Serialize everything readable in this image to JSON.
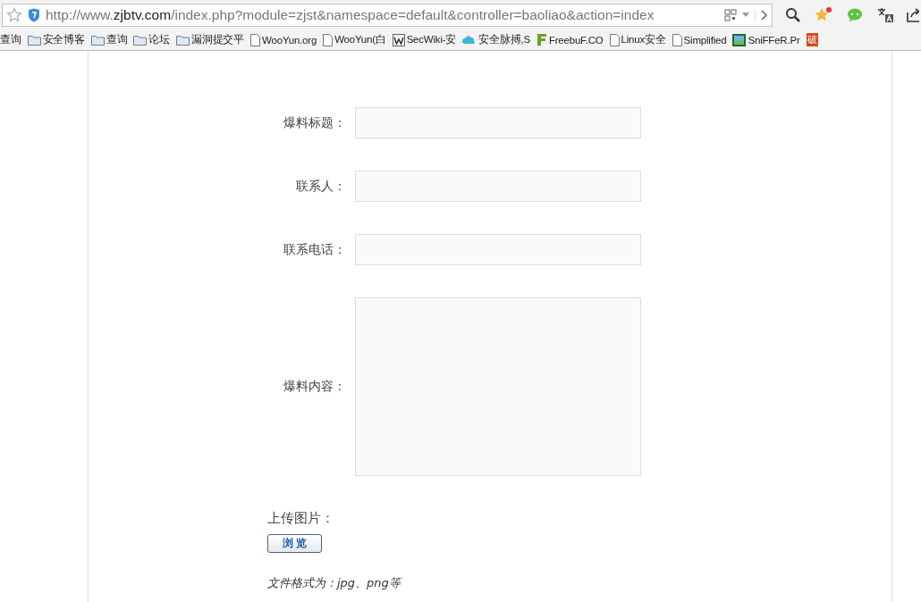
{
  "address_bar": {
    "url_prefix": "http://www.",
    "url_domain": "zjbtv.com",
    "url_path": "/index.php?module=zjst&namespace=default&controller=baoliao&action=index"
  },
  "bookmarks": [
    {
      "kind": "plain",
      "label": "查询"
    },
    {
      "kind": "folder",
      "label": "安全博客"
    },
    {
      "kind": "folder",
      "label": "查询"
    },
    {
      "kind": "folder",
      "label": "论坛"
    },
    {
      "kind": "folder",
      "label": "漏洞提交平"
    },
    {
      "kind": "page",
      "label": "WooYun.org"
    },
    {
      "kind": "page",
      "label": "WooYun(白"
    },
    {
      "kind": "wiki",
      "label": "SecWiki-安"
    },
    {
      "kind": "cloud",
      "label": "安全脉搏,S"
    },
    {
      "kind": "freebuf",
      "label": "FreebuF.CO"
    },
    {
      "kind": "page",
      "label": "Linux安全"
    },
    {
      "kind": "page",
      "label": "Simplified"
    },
    {
      "kind": "picture",
      "label": "SniFFeR.Pr"
    },
    {
      "kind": "tile",
      "label": "破"
    }
  ],
  "form": {
    "fields": [
      {
        "kind": "input",
        "label": "爆料标题："
      },
      {
        "kind": "input",
        "label": "联系人："
      },
      {
        "kind": "input",
        "label": "联系电话："
      },
      {
        "kind": "textarea",
        "label": "爆料内容："
      }
    ],
    "upload_label": "上传图片：",
    "browse_button": "浏 览",
    "format_note": "文件格式为：jpg、png等"
  }
}
